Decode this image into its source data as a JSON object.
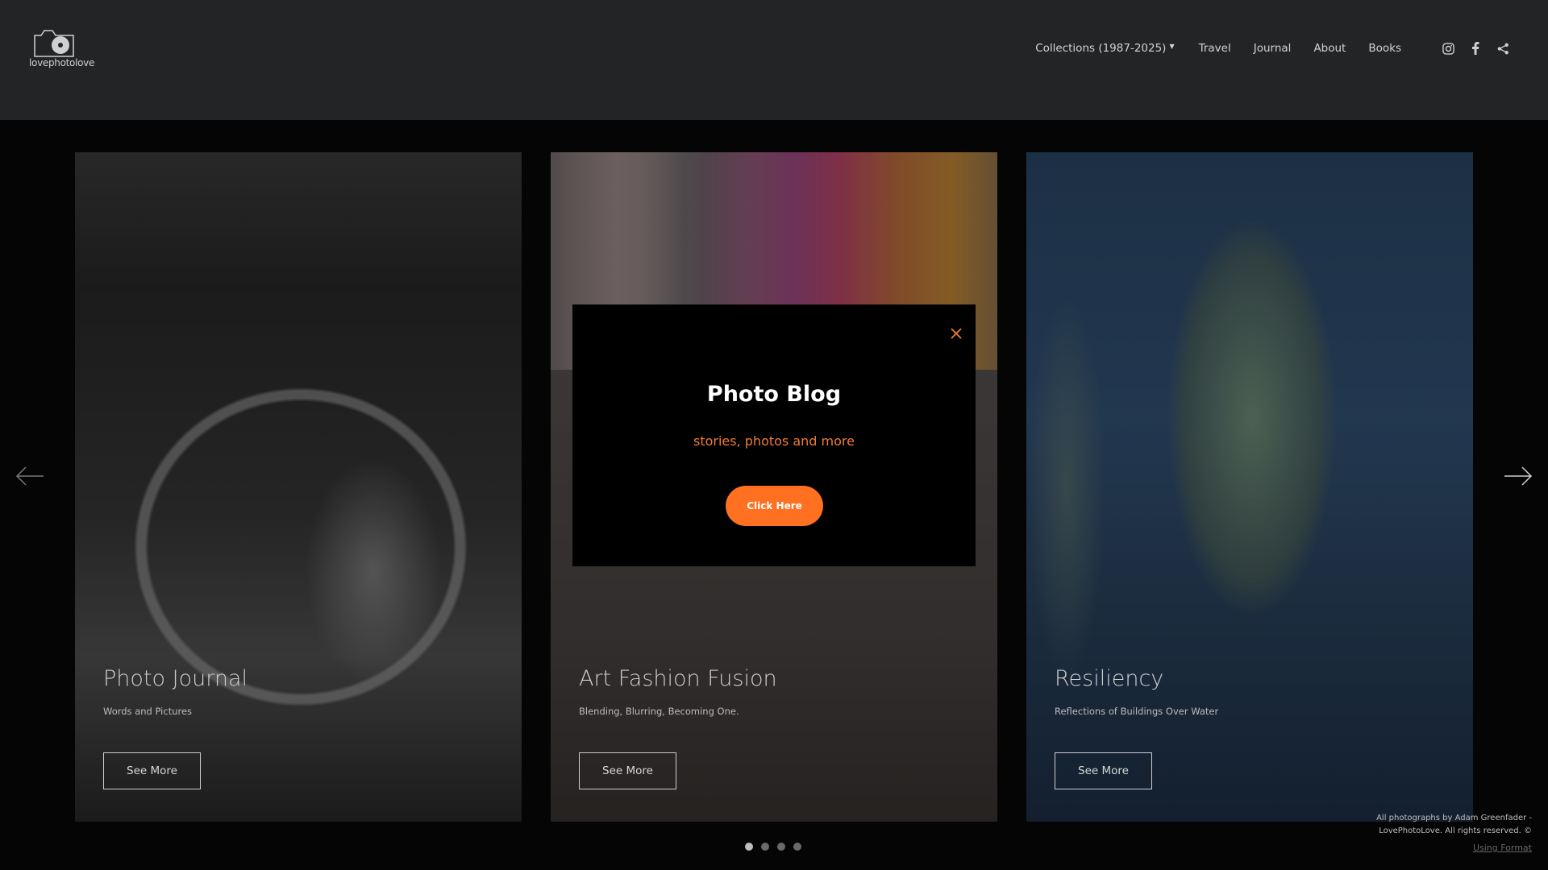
{
  "logo": {
    "text": "lovephotolove",
    "icon": "camera-icon"
  },
  "nav": {
    "items": [
      {
        "label": "Collections (1987-2025)",
        "has_dropdown": true
      },
      {
        "label": "Travel"
      },
      {
        "label": "Journal"
      },
      {
        "label": "About"
      },
      {
        "label": "Books"
      }
    ],
    "social": [
      "instagram-icon",
      "facebook-icon",
      "share-icon"
    ]
  },
  "cards": [
    {
      "title": "Photo Journal",
      "subtitle": "Words and Pictures",
      "button": "See More"
    },
    {
      "title": "Art Fashion Fusion",
      "subtitle": "Blending, Blurring, Becoming One.",
      "button": "See More"
    },
    {
      "title": "Resiliency",
      "subtitle": "Reflections of Buildings Over Water",
      "button": "See More"
    }
  ],
  "carousel": {
    "dots": 4,
    "active_dot": 1
  },
  "modal": {
    "title": "Photo Blog",
    "subtitle": "stories, photos and more",
    "button": "Click Here",
    "accent_color": "#ff7020"
  },
  "footer": {
    "credit_line1": "All photographs by Adam Greenfader -",
    "credit_line2": "LovePhotoLove. All rights reserved. ©",
    "using": "Using Format"
  }
}
